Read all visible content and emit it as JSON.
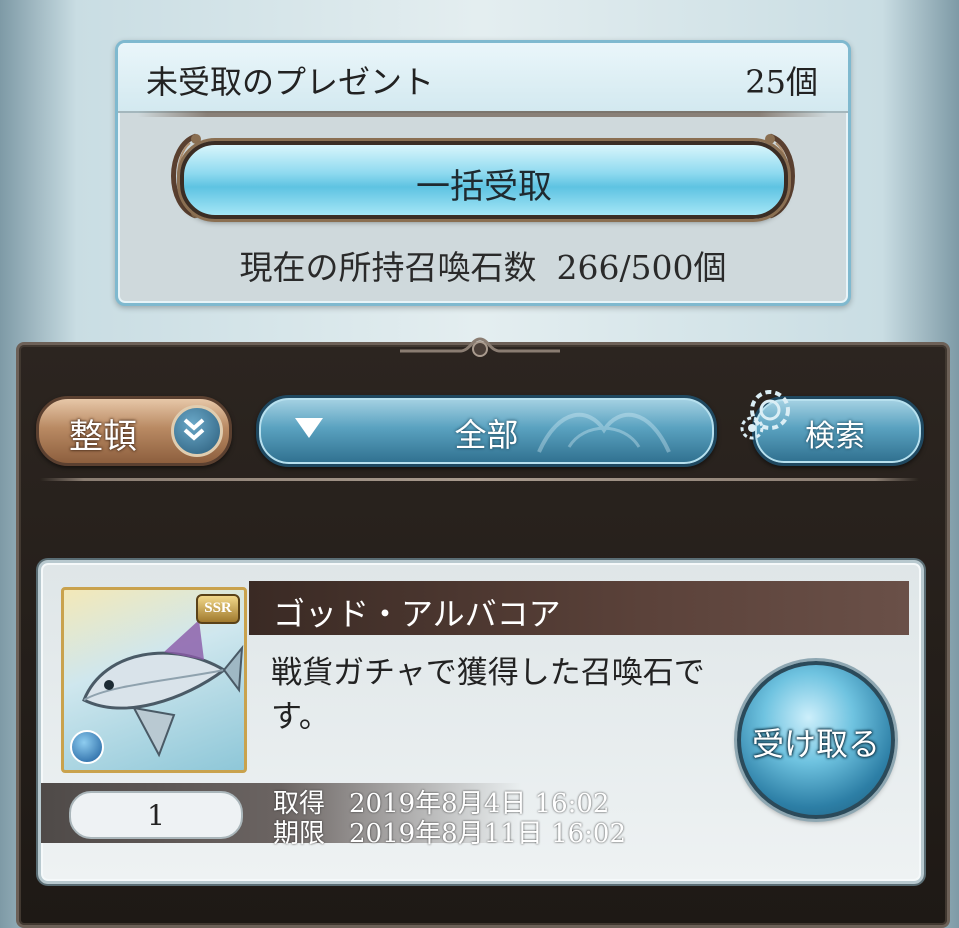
{
  "present_box": {
    "title": "未受取のプレゼント",
    "count": "25個",
    "bulk_receive_label": "一括受取",
    "stone_label": "現在の所持召喚石数",
    "stone_count": "266/500個"
  },
  "filters": {
    "sort_label": "整頓",
    "category_label": "全部",
    "search_label": "検索"
  },
  "items": [
    {
      "name": "ゴッド・アルバコア",
      "description": "戦貨ガチャで獲得した召喚石です。",
      "rarity": "SSR",
      "quantity": "1",
      "acquired_label": "取得",
      "acquired_date": "2019年8月4日 16:02",
      "expiry_label": "期限",
      "expiry_date": "2019年8月11日 16:02",
      "receive_label": "受け取る",
      "element_icon": "water-icon"
    }
  ],
  "colors": {
    "accent_blue": "#5ec3e2",
    "panel_dark": "#2c2520",
    "sort_brown": "#b98a63"
  }
}
